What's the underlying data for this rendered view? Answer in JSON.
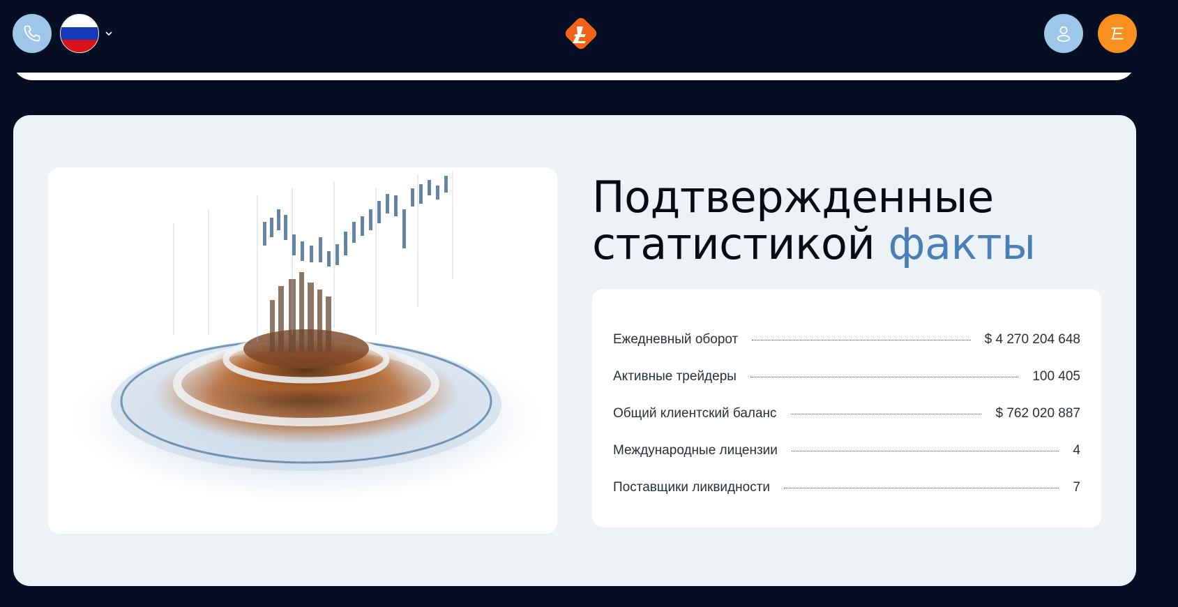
{
  "header": {
    "phone_icon": "phone-icon",
    "language_flag": "russian-flag",
    "user_icon": "user-icon",
    "menu_icon": "menu-icon",
    "colors": {
      "background": "#050e22",
      "light_blue": "#9dc6e9",
      "orange": "#f7901e"
    }
  },
  "section": {
    "heading_line1": "Подтвержденные",
    "heading_line2_main": "статистикой",
    "heading_line2_accent": "факты",
    "accent_color": "#4a7fb7",
    "stats": [
      {
        "label": "Ежедневный оборот",
        "value": "$ 4 270 204 648"
      },
      {
        "label": "Активные трейдеры",
        "value": "100 405"
      },
      {
        "label": "Общий клиентский баланс",
        "value": "$ 762 020 887"
      },
      {
        "label": "Международные лицензии",
        "value": "4"
      },
      {
        "label": "Поставщики ликвидности",
        "value": "7"
      }
    ]
  }
}
